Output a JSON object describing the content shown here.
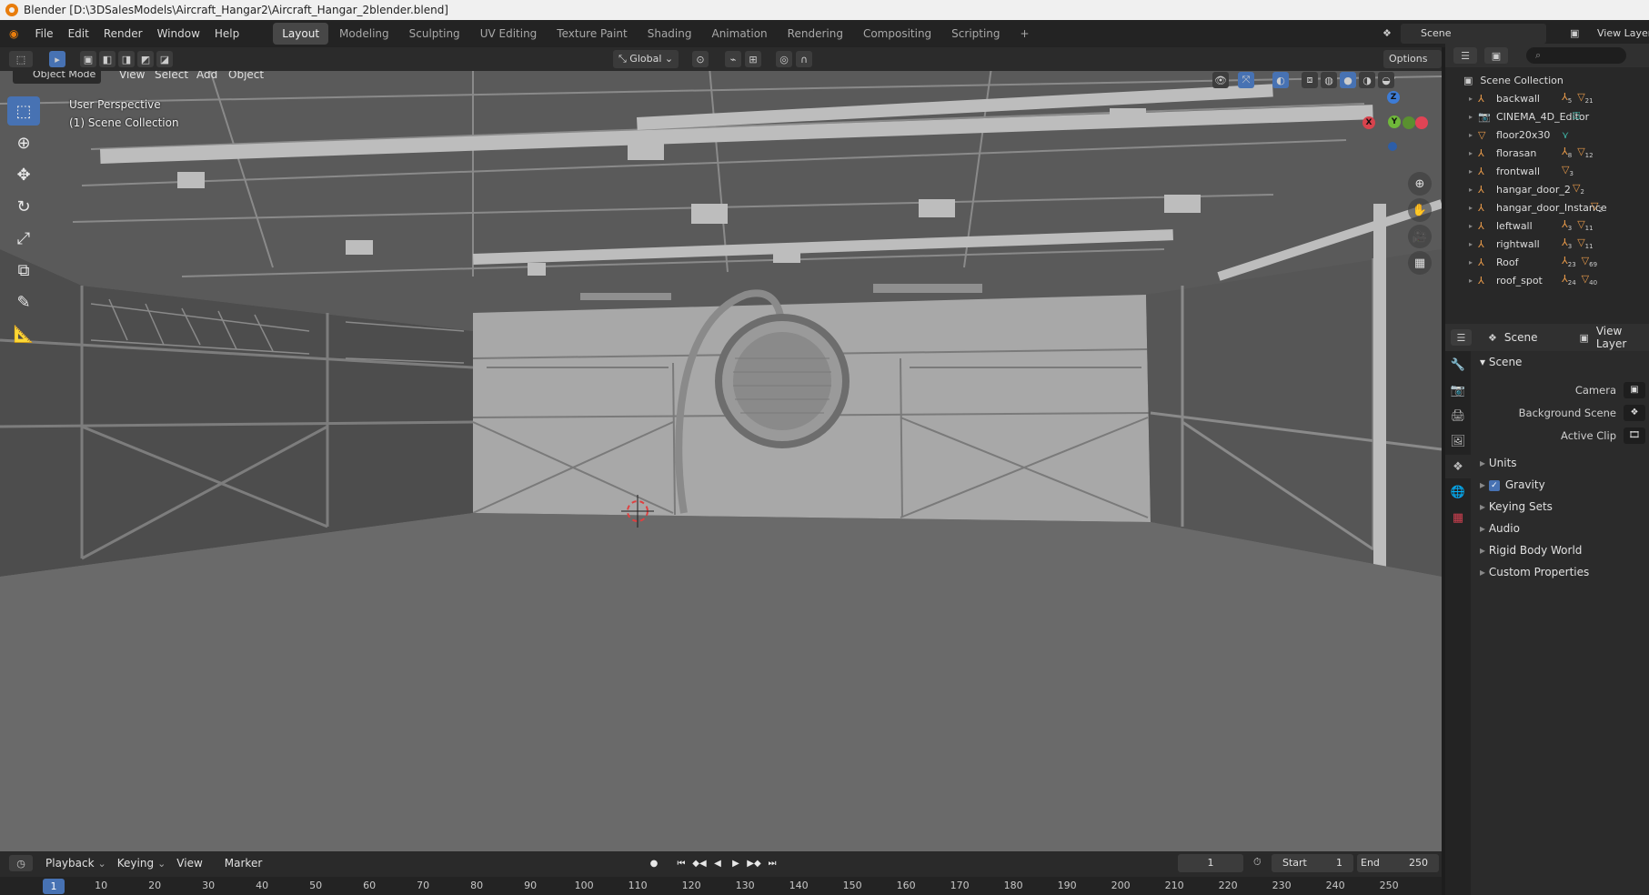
{
  "window": {
    "title": "Blender [D:\\3DSalesModels\\Aircraft_Hangar2\\Aircraft_Hangar_2blender.blend]"
  },
  "menubar": {
    "menus": [
      "File",
      "Edit",
      "Render",
      "Window",
      "Help"
    ],
    "workspaces": [
      "Layout",
      "Modeling",
      "Sculpting",
      "UV Editing",
      "Texture Paint",
      "Shading",
      "Animation",
      "Rendering",
      "Compositing",
      "Scripting"
    ],
    "active_workspace": "Layout",
    "add_workspace": "+",
    "scene": "Scene",
    "view_layer": "View Layer"
  },
  "viewport": {
    "mode": "Object Mode",
    "menus": [
      "View",
      "Select",
      "Add",
      "Object"
    ],
    "transform_orientation": "Global",
    "options": "Options",
    "perspective_label": "User Perspective",
    "collection_label": "(1) Scene Collection",
    "gizmo": {
      "x": "X",
      "y": "Y",
      "z": "Z"
    }
  },
  "outliner": {
    "root": "Scene Collection",
    "items": [
      {
        "name": "backwall",
        "badges": [
          "5",
          "21"
        ]
      },
      {
        "name": "CINEMA_4D_Editor",
        "badges": []
      },
      {
        "name": "floor20x30",
        "badges": []
      },
      {
        "name": "florasan",
        "badges": [
          "8",
          "12"
        ]
      },
      {
        "name": "frontwall",
        "badges": [
          "3"
        ]
      },
      {
        "name": "hangar_door_2",
        "badges": [
          "2"
        ]
      },
      {
        "name": "hangar_door_Instance",
        "badges": [
          "2"
        ]
      },
      {
        "name": "leftwall",
        "badges": [
          "3",
          "11"
        ]
      },
      {
        "name": "rightwall",
        "badges": [
          "3",
          "11"
        ]
      },
      {
        "name": "Roof",
        "badges": [
          "23",
          "69"
        ]
      },
      {
        "name": "roof_spot",
        "badges": [
          "24",
          "40"
        ]
      }
    ]
  },
  "properties": {
    "header_scene": "Scene",
    "header_view_layer": "View Layer",
    "section": "Scene",
    "fields": [
      "Camera",
      "Background Scene",
      "Active Clip"
    ],
    "panels": [
      "Units",
      "Gravity",
      "Keying Sets",
      "Audio",
      "Rigid Body World",
      "Custom Properties"
    ],
    "gravity_checked": true
  },
  "timeline": {
    "menus": [
      "Playback",
      "Keying",
      "View",
      "Marker"
    ],
    "current_frame": "1",
    "start_label": "Start",
    "start": "1",
    "end_label": "End",
    "end": "250",
    "ruler": [
      "1",
      "10",
      "20",
      "30",
      "40",
      "50",
      "60",
      "70",
      "80",
      "90",
      "100",
      "110",
      "120",
      "130",
      "140",
      "150",
      "160",
      "170",
      "180",
      "190",
      "200",
      "210",
      "220",
      "230",
      "240",
      "250"
    ]
  },
  "colors": {
    "accent": "#4772b3",
    "object_orange": "#e89a4a",
    "viewport_bg": "#6e6e6e"
  }
}
